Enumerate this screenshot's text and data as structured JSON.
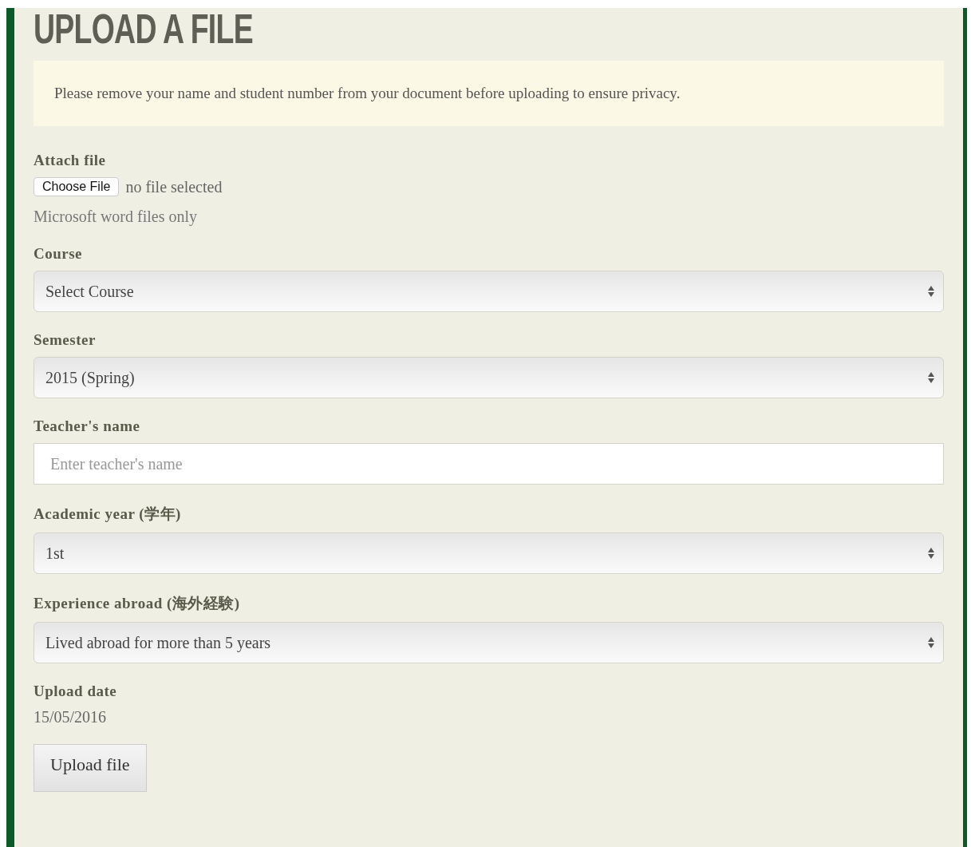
{
  "heading": "UPLOAD A FILE",
  "notice": "Please remove your name and student number from your document before uploading to ensure privacy.",
  "fields": [
    {
      "kind": "file",
      "label": "Attach file",
      "button": "Choose File",
      "status": "no file selected",
      "hint": "Microsoft word files only"
    },
    {
      "kind": "select",
      "label": "Course",
      "value": "Select Course"
    },
    {
      "kind": "select",
      "label": "Semester",
      "value": "2015 (Spring)"
    },
    {
      "kind": "text",
      "label": "Teacher's name",
      "placeholder": "Enter teacher's name"
    },
    {
      "kind": "select",
      "label": "Academic year (学年)",
      "value": "1st"
    },
    {
      "kind": "select",
      "label": "Experience abroad (海外経験)",
      "value": "Lived abroad for more than 5 years"
    },
    {
      "kind": "static",
      "label": "Upload date",
      "value": "15/05/2016"
    }
  ],
  "submit": "Upload file"
}
